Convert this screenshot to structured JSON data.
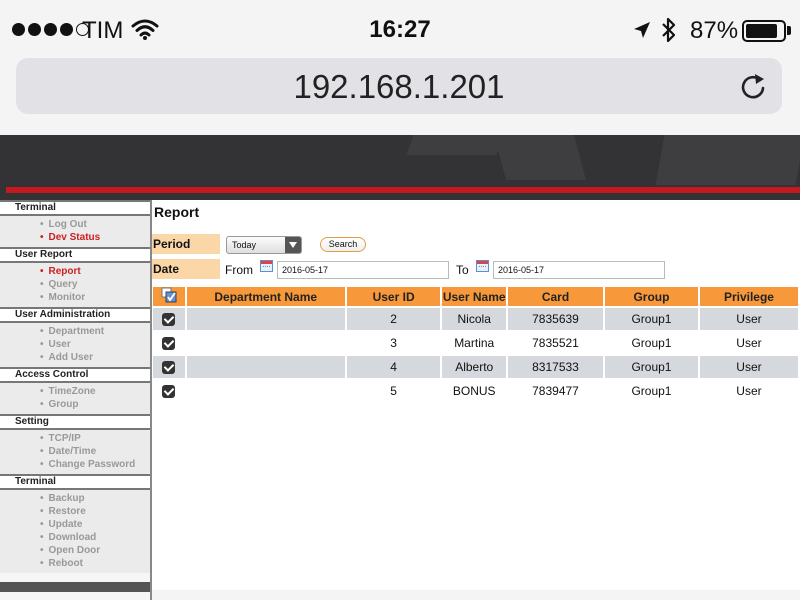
{
  "status_bar": {
    "carrier": "TIM",
    "time": "16:27",
    "battery": "87%",
    "battery_level": 0.87,
    "signal_bars_filled": 4,
    "signal_bars_total": 5,
    "icons": [
      "wifi-icon",
      "location-arrow-icon",
      "bluetooth-icon",
      "battery-icon"
    ]
  },
  "browser": {
    "url": "192.168.1.201",
    "reload_icon": "reload-icon"
  },
  "colors": {
    "accent_red": "#c41a1f",
    "header_bg": "#333335",
    "table_header": "#f7993a",
    "label_bg": "#fbd7a8",
    "row_alt": "#d5d8dc"
  },
  "sidebar": {
    "sections": [
      {
        "title": "Terminal",
        "items": [
          {
            "label": "Log Out",
            "active": false
          },
          {
            "label": "Dev Status",
            "active": true
          }
        ]
      },
      {
        "title": "User Report",
        "items": [
          {
            "label": "Report",
            "active": true
          },
          {
            "label": "Query",
            "active": false
          },
          {
            "label": "Monitor",
            "active": false
          }
        ]
      },
      {
        "title": "User Administration",
        "items": [
          {
            "label": "Department",
            "active": false
          },
          {
            "label": "User",
            "active": false
          },
          {
            "label": "Add User",
            "active": false
          }
        ]
      },
      {
        "title": "Access Control",
        "items": [
          {
            "label": "TimeZone",
            "active": false
          },
          {
            "label": "Group",
            "active": false
          }
        ]
      },
      {
        "title": "Setting",
        "items": [
          {
            "label": "TCP/IP",
            "active": false
          },
          {
            "label": "Date/Time",
            "active": false
          },
          {
            "label": "Change Password",
            "active": false
          }
        ]
      },
      {
        "title": "Terminal",
        "items": [
          {
            "label": "Backup",
            "active": false
          },
          {
            "label": "Restore",
            "active": false
          },
          {
            "label": "Update",
            "active": false
          },
          {
            "label": "Download",
            "active": false
          },
          {
            "label": "Open Door",
            "active": false
          },
          {
            "label": "Reboot",
            "active": false
          }
        ]
      }
    ]
  },
  "report": {
    "title": "Report",
    "period_label": "Period",
    "period_value": "Today",
    "search_label": "Search",
    "date_label": "Date",
    "from_label": "From",
    "from_value": "2016-05-17",
    "to_label": "To",
    "to_value": "2016-05-17",
    "table": {
      "select_all_icon": "select-all-icon",
      "columns": [
        "Department Name",
        "User ID",
        "User Name",
        "Card",
        "Group",
        "Privilege"
      ],
      "rows": [
        {
          "checked": true,
          "department": "",
          "user_id": "2",
          "user_name": "Nicola",
          "card": "7835639",
          "group": "Group1",
          "privilege": "User"
        },
        {
          "checked": true,
          "department": "",
          "user_id": "3",
          "user_name": "Martina",
          "card": "7835521",
          "group": "Group1",
          "privilege": "User"
        },
        {
          "checked": true,
          "department": "",
          "user_id": "4",
          "user_name": "Alberto",
          "card": "8317533",
          "group": "Group1",
          "privilege": "User"
        },
        {
          "checked": true,
          "department": "",
          "user_id": "5",
          "user_name": "BONUS",
          "card": "7839477",
          "group": "Group1",
          "privilege": "User"
        }
      ]
    }
  }
}
